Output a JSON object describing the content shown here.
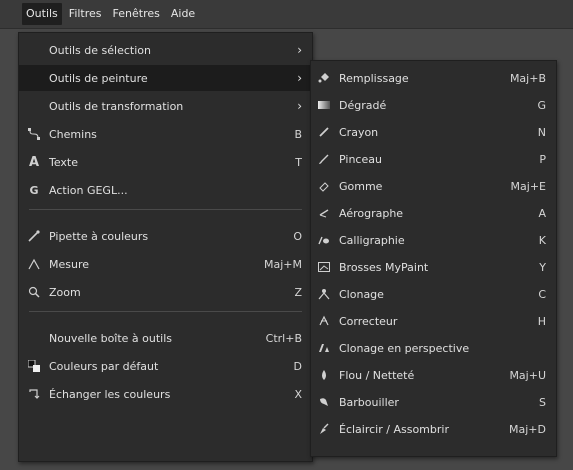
{
  "menubar": {
    "items": [
      "Outils",
      "Filtres",
      "Fenêtres",
      "Aide"
    ]
  },
  "tools_menu": {
    "items": [
      {
        "label": "Outils de sélection",
        "shortcut": "",
        "submenu": true,
        "icon": ""
      },
      {
        "label": "Outils de peinture",
        "shortcut": "",
        "submenu": true,
        "icon": "",
        "highlighted": true
      },
      {
        "label": "Outils de transformation",
        "shortcut": "",
        "submenu": true,
        "icon": ""
      },
      {
        "label": "Chemins",
        "shortcut": "B",
        "icon": "paths-icon"
      },
      {
        "label": "Texte",
        "shortcut": "T",
        "icon": "text-icon"
      },
      {
        "label": "Action GEGL...",
        "shortcut": "",
        "icon": "gegl-icon"
      },
      {
        "label": "Pipette à couleurs",
        "shortcut": "O",
        "icon": "color-picker-icon"
      },
      {
        "label": "Mesure",
        "shortcut": "Maj+M",
        "icon": "measure-icon"
      },
      {
        "label": "Zoom",
        "shortcut": "Z",
        "icon": "zoom-icon"
      },
      {
        "label": "Nouvelle boîte à outils",
        "shortcut": "Ctrl+B",
        "icon": ""
      },
      {
        "label": "Couleurs par défaut",
        "shortcut": "D",
        "icon": "default-colors-icon"
      },
      {
        "label": "Échanger les couleurs",
        "shortcut": "X",
        "icon": "swap-colors-icon"
      }
    ]
  },
  "paint_menu": {
    "items": [
      {
        "label": "Remplissage",
        "shortcut": "Maj+B",
        "icon": "bucket-fill-icon"
      },
      {
        "label": "Dégradé",
        "shortcut": "G",
        "icon": "gradient-icon"
      },
      {
        "label": "Crayon",
        "shortcut": "N",
        "icon": "pencil-icon"
      },
      {
        "label": "Pinceau",
        "shortcut": "P",
        "icon": "paintbrush-icon"
      },
      {
        "label": "Gomme",
        "shortcut": "Maj+E",
        "icon": "eraser-icon"
      },
      {
        "label": "Aérographe",
        "shortcut": "A",
        "icon": "airbrush-icon"
      },
      {
        "label": "Calligraphie",
        "shortcut": "K",
        "icon": "ink-icon"
      },
      {
        "label": "Brosses MyPaint",
        "shortcut": "Y",
        "icon": "mypaint-brush-icon"
      },
      {
        "label": "Clonage",
        "shortcut": "C",
        "icon": "clone-icon"
      },
      {
        "label": "Correcteur",
        "shortcut": "H",
        "icon": "heal-icon"
      },
      {
        "label": "Clonage en perspective",
        "shortcut": "",
        "icon": "perspective-clone-icon"
      },
      {
        "label": "Flou / Netteté",
        "shortcut": "Maj+U",
        "icon": "blur-sharpen-icon"
      },
      {
        "label": "Barbouiller",
        "shortcut": "S",
        "icon": "smudge-icon"
      },
      {
        "label": "Éclaircir / Assombrir",
        "shortcut": "Maj+D",
        "icon": "dodge-burn-icon"
      }
    ]
  }
}
